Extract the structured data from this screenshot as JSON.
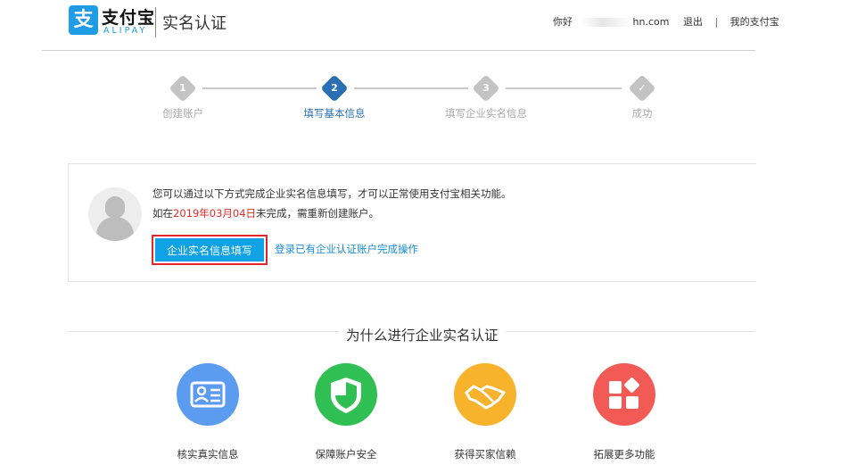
{
  "header": {
    "logo_cn": "支付宝",
    "logo_en": "ALIPAY",
    "logo_glyph": "支",
    "page_title": "实名认证",
    "greeting": "你好",
    "email_suffix": "hn.com",
    "logout": "退出",
    "separator": "|",
    "my_alipay": "我的支付宝"
  },
  "steps": [
    {
      "num": "1",
      "label": "创建账户",
      "state": "done"
    },
    {
      "num": "2",
      "label": "填写基本信息",
      "state": "active"
    },
    {
      "num": "3",
      "label": "填写企业实名信息",
      "state": "pending"
    },
    {
      "num": "✓",
      "label": "成功",
      "state": "pending"
    }
  ],
  "notice": {
    "line1": "您可以通过以下方式完成企业实名信息填写，才可以正常使用支付宝相关功能。",
    "line2_prefix": "如在",
    "line2_date": "2019年03月04日",
    "line2_suffix": "未完成，需重新创建账户。",
    "primary_button": "企业实名信息填写",
    "alt_link": "登录已有企业认证账户完成操作"
  },
  "why": {
    "title": "为什么进行企业实名认证",
    "features": [
      {
        "label": "核实真实信息",
        "icon": "id-card-icon",
        "color": "#5b9bf0"
      },
      {
        "label": "保障账户安全",
        "icon": "shield-icon",
        "color": "#2fbf52"
      },
      {
        "label": "获得买家信赖",
        "icon": "handshake-icon",
        "color": "#f7b32b"
      },
      {
        "label": "拓展更多功能",
        "icon": "apps-icon",
        "color": "#f25a56"
      }
    ]
  },
  "colors": {
    "brand_blue": "#1e9ce6",
    "step_active": "#2a6fb3",
    "button_blue": "#0fa2e5",
    "highlight_red": "#e2262a",
    "date_red": "#e02a2a",
    "link_blue": "#1a8dd6"
  }
}
